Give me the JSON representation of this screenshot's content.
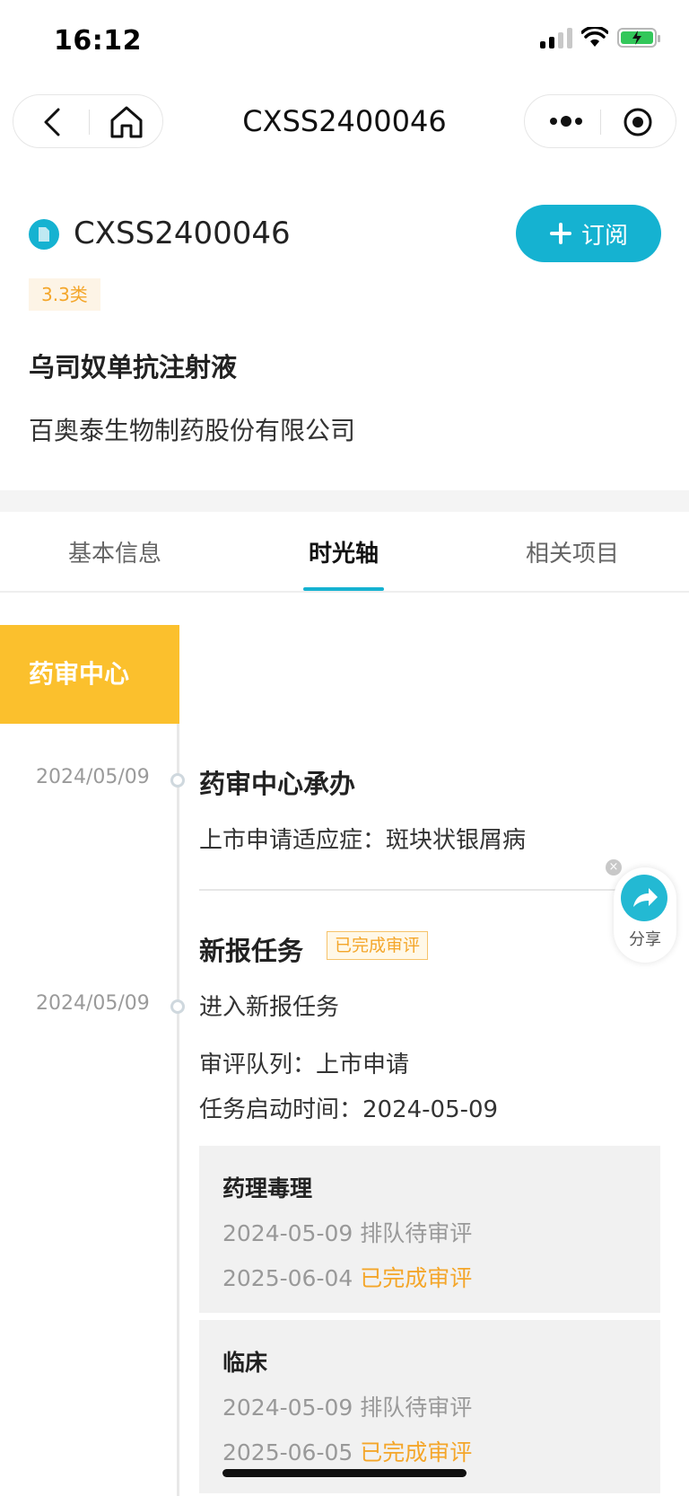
{
  "status_bar": {
    "time": "16:12"
  },
  "nav": {
    "title": "CXSS2400046"
  },
  "header": {
    "doc_id": "CXSS2400046",
    "subscribe_label": "订阅",
    "category": "3.3类",
    "drug_name": "乌司奴单抗注射液",
    "company": "百奥泰生物制药股份有限公司"
  },
  "tabs": [
    {
      "label": "基本信息",
      "active": false
    },
    {
      "label": "时光轴",
      "active": true
    },
    {
      "label": "相关项目",
      "active": false
    }
  ],
  "timeline": {
    "center_label": "药审中心",
    "events": [
      {
        "date": "2024/05/09",
        "title": "药审中心承办",
        "lines": [
          "上市申请适应症：斑块状银屑病"
        ]
      },
      {
        "date": "2024/05/09",
        "title": "新报任务",
        "tag": "已完成审评",
        "lines": [
          "进入新报任务",
          "审评队列：上市申请",
          "任务启动时间：2024-05-09"
        ],
        "reviews": [
          {
            "title": "药理毒理",
            "queued_date": "2024-05-09",
            "queued_status": "排队待审评",
            "done_date": "2025-06-04",
            "done_status": "已完成审评"
          },
          {
            "title": "临床",
            "queued_date": "2024-05-09",
            "queued_status": "排队待审评",
            "done_date": "2025-06-05",
            "done_status": "已完成审评"
          }
        ]
      }
    ]
  },
  "share": {
    "label": "分享"
  },
  "colors": {
    "accent": "#15b2d1",
    "center_label_bg": "#fbc02d",
    "status_done": "#f4a62a"
  }
}
